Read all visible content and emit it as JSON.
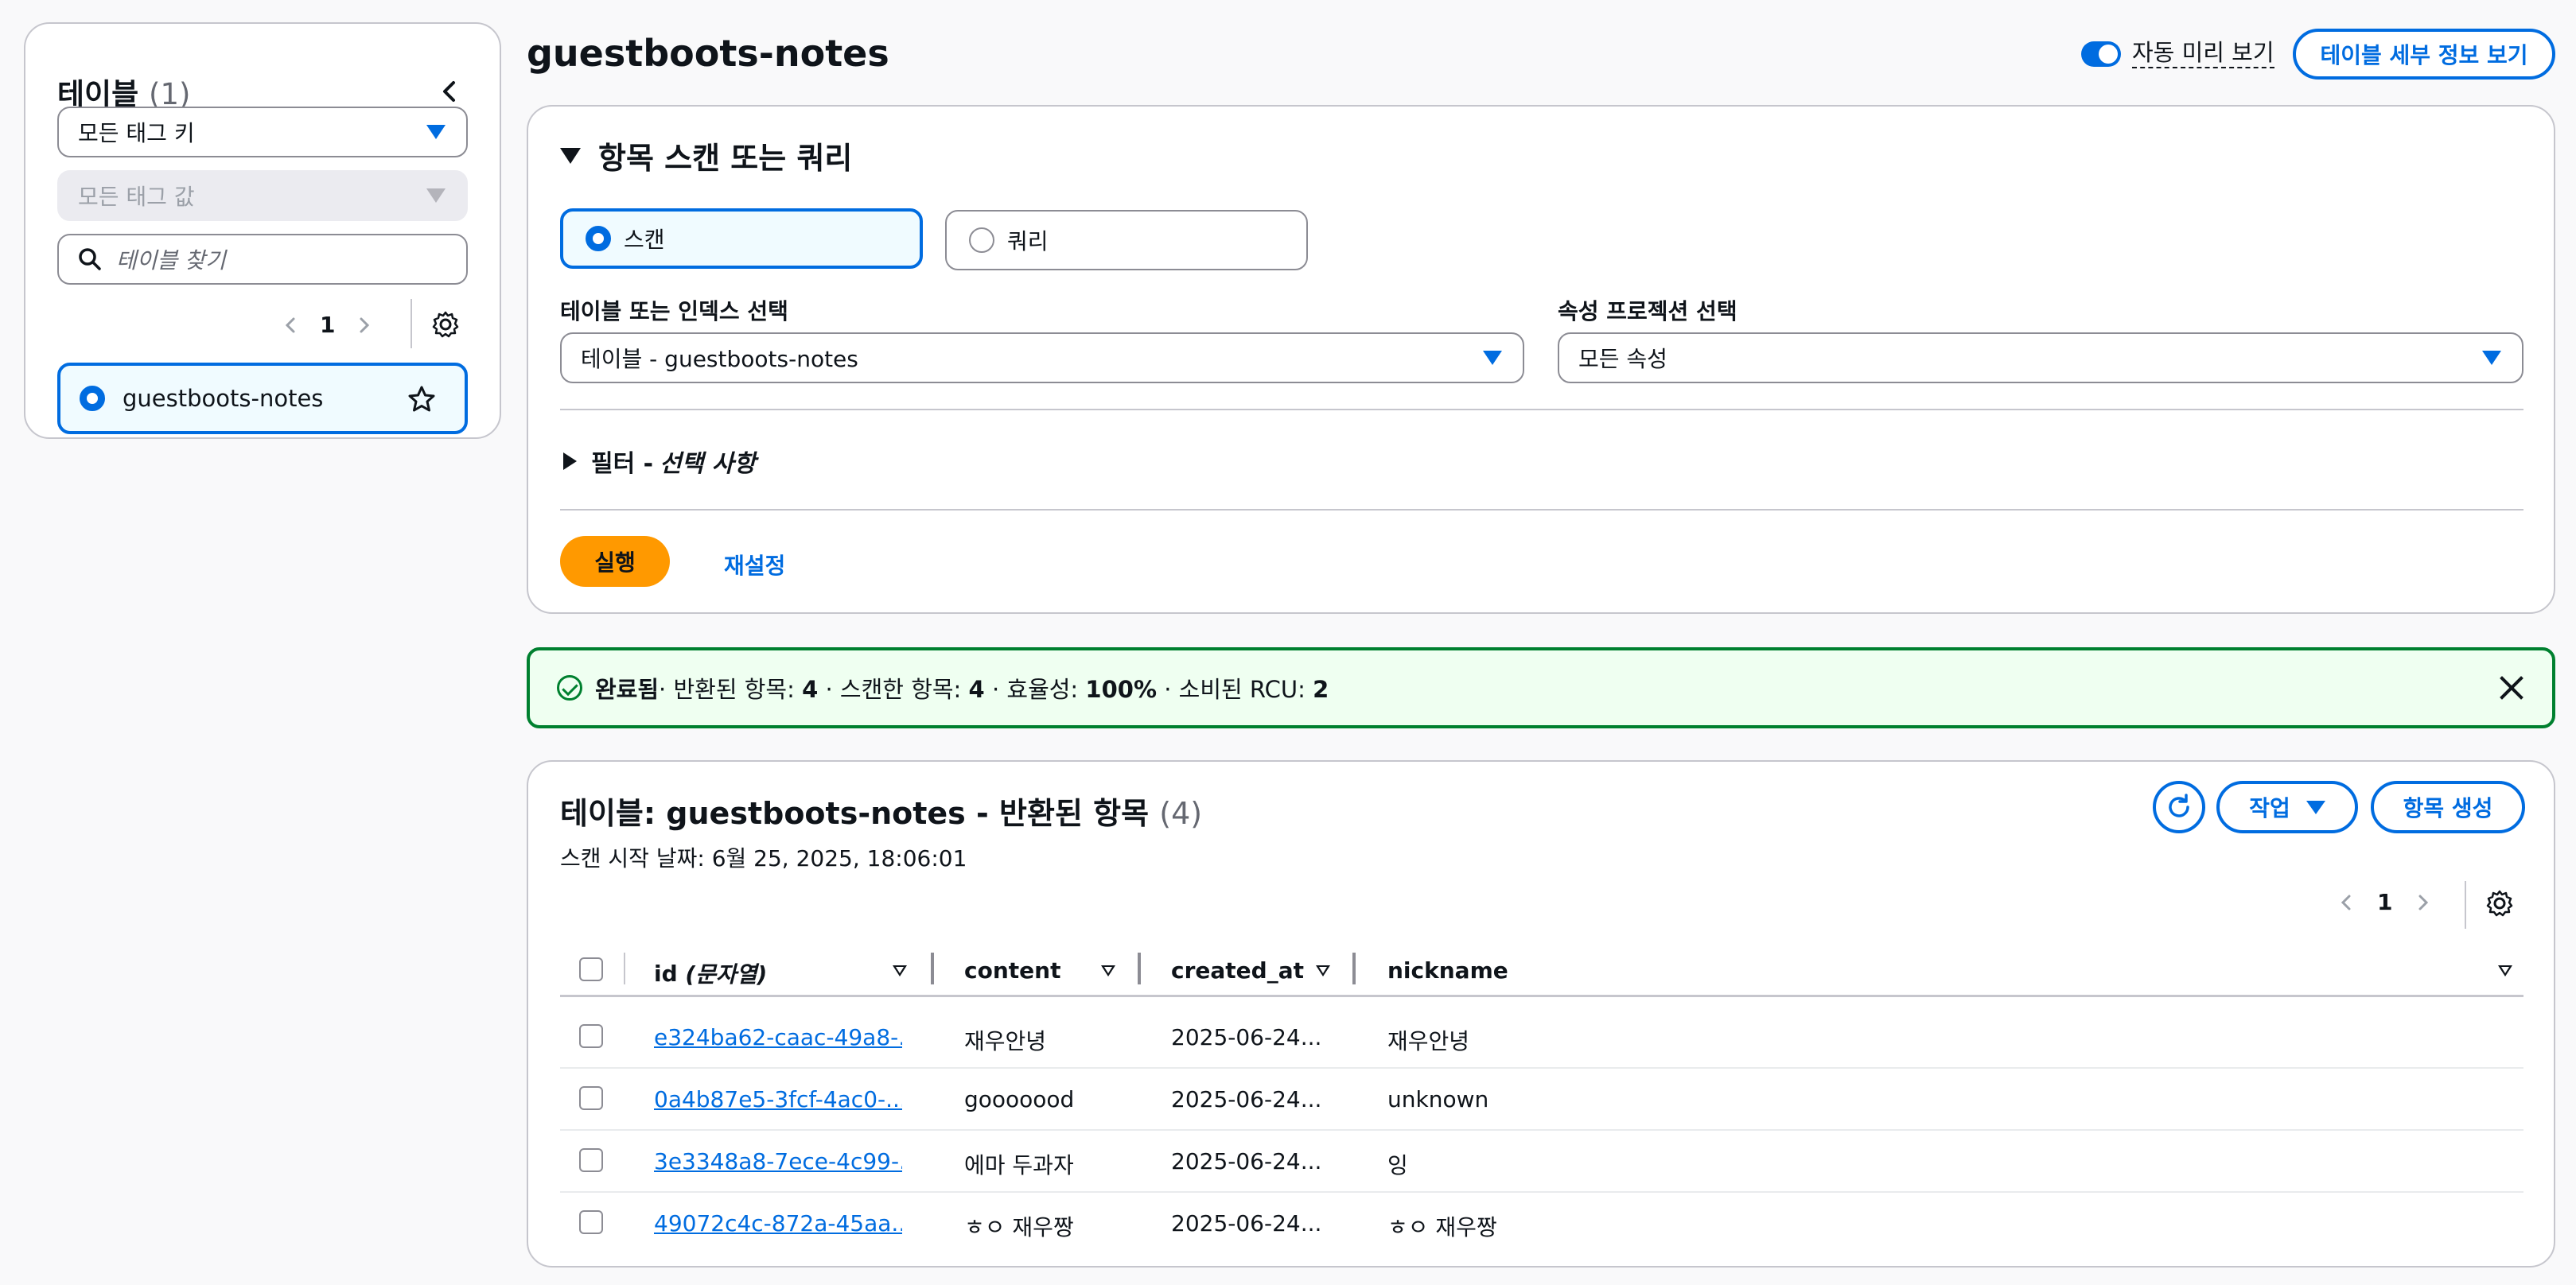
{
  "sidebar": {
    "title": "테이블",
    "count": "(1)",
    "tag_key_select": "모든 태그 키",
    "tag_value_select": "모든 태그 값",
    "search_placeholder": "테이블 찾기",
    "page": "1",
    "items": [
      {
        "label": "guestboots-notes"
      }
    ]
  },
  "header": {
    "title": "guestboots-notes",
    "auto_preview_label": "자동 미리 보기",
    "details_button": "테이블 세부 정보 보기"
  },
  "scan": {
    "section_title": "항목 스캔 또는 쿼리",
    "mode_scan": "스캔",
    "mode_query": "쿼리",
    "table_label": "테이블 또는 인덱스 선택",
    "table_value": "테이블 - guestboots-notes",
    "projection_label": "속성 프로젝션 선택",
    "projection_value": "모든 속성",
    "filter_title": "필터 - ",
    "filter_optional": "선택 사항",
    "run_button": "실행",
    "reset_button": "재설정"
  },
  "alert": {
    "status": "완료됨",
    "returned_label": "· 반환된 항목: ",
    "returned_value": "4",
    "scanned_label": " · 스캔한 항목: ",
    "scanned_value": "4",
    "efficiency_label": " · 효율성: ",
    "efficiency_value": "100%",
    "rcu_label": " · 소비된 RCU: ",
    "rcu_value": "2"
  },
  "results": {
    "title": "테이블: guestboots-notes - 반환된 항목",
    "count": "(4)",
    "subtitle": "스캔 시작 날짜: 6월 25, 2025, 18:06:01",
    "actions_button": "작업",
    "create_button": "항목 생성",
    "page": "1",
    "columns": {
      "id": "id",
      "id_type": "(문자열)",
      "content": "content",
      "created_at": "created_at",
      "nickname": "nickname"
    },
    "rows": [
      {
        "id": "e324ba62-caac-49a8-...",
        "content": "재우안녕",
        "created_at": "2025-06-24...",
        "nickname": "재우안녕"
      },
      {
        "id": "0a4b87e5-3fcf-4ac0-...",
        "content": "gooooood",
        "created_at": "2025-06-24...",
        "nickname": "unknown"
      },
      {
        "id": "3e3348a8-7ece-4c99-...",
        "content": "에마 두과자",
        "created_at": "2025-06-24...",
        "nickname": "잉"
      },
      {
        "id": "49072c4c-872a-45aa...",
        "content": "ㅎㅇ 재우짱",
        "created_at": "2025-06-24...",
        "nickname": "ㅎㅇ 재우짱"
      }
    ]
  },
  "colors": {
    "accent": "#006ce0",
    "run_button": "#ff9900",
    "success": "#00802f"
  }
}
